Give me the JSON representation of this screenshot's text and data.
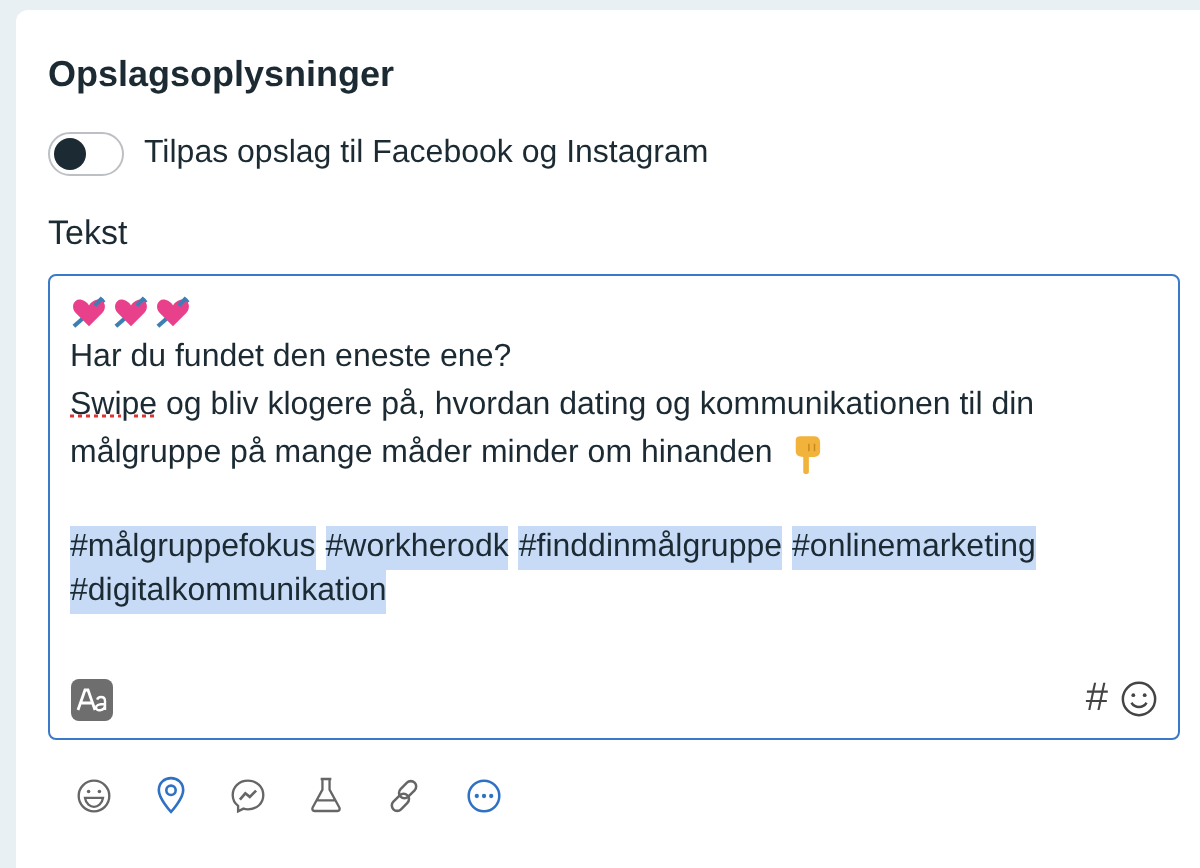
{
  "section_title": "Opslagsoplysninger",
  "toggle": {
    "label": "Tilpas opslag til Facebook og Instagram",
    "on": false
  },
  "text_field": {
    "label": "Tekst",
    "lines": [
      {
        "kind": "hearts"
      },
      {
        "kind": "plain",
        "text": "Har du fundet den eneste ene?"
      },
      {
        "kind": "spelled",
        "misspelled": "Swipe",
        "rest": " og bliv klogere på, hvordan dating og kommunikationen til din"
      },
      {
        "kind": "plain",
        "text": "målgruppe på mange måder minder om hinanden",
        "pointing": true
      },
      {
        "kind": "blank"
      },
      {
        "kind": "hashtags",
        "tags": [
          "#målgruppefokus",
          "#workherodk",
          "#finddinmålgruppe",
          "#onlinemarketing",
          "#digitalkommunikation"
        ],
        "highlighted": true
      }
    ],
    "hash_key": "#"
  },
  "toolbar": [
    {
      "kind": "emoji",
      "highlighted": false
    },
    {
      "kind": "location",
      "highlighted": true
    },
    {
      "kind": "messenger",
      "highlighted": false
    },
    {
      "kind": "flask",
      "highlighted": false
    },
    {
      "kind": "link",
      "highlighted": false
    },
    {
      "kind": "more",
      "highlighted": true
    }
  ]
}
